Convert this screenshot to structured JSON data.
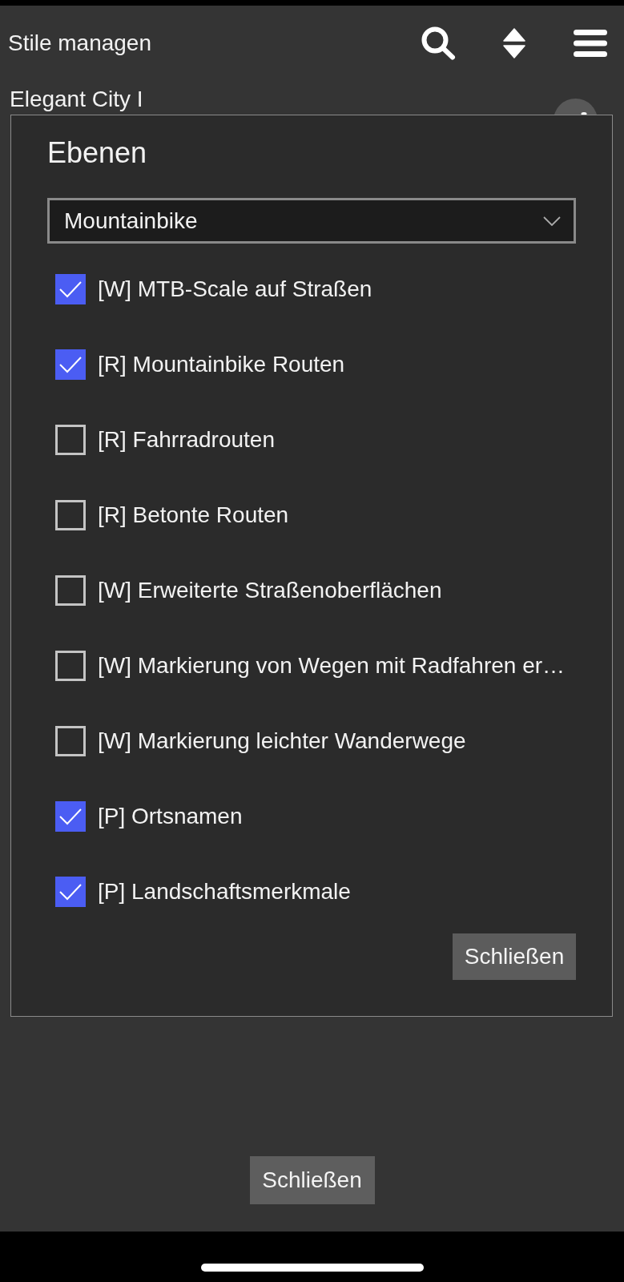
{
  "app_bar": {
    "title": "Stile managen"
  },
  "background_list": {
    "items": [
      {
        "label": "Elegant City I"
      }
    ]
  },
  "dialog": {
    "title": "Ebenen",
    "dropdown": {
      "value": "Mountainbike"
    },
    "layers": [
      {
        "label": "[W] MTB-Scale auf Straßen",
        "checked": true
      },
      {
        "label": "[R] Mountainbike Routen",
        "checked": true
      },
      {
        "label": "[R] Fahrradrouten",
        "checked": false
      },
      {
        "label": "[R] Betonte Routen",
        "checked": false
      },
      {
        "label": "[W] Erweiterte Straßenoberflächen",
        "checked": false
      },
      {
        "label": "[W] Markierung von Wegen mit Radfahren er…",
        "checked": false
      },
      {
        "label": "[W] Markierung leichter Wanderwege",
        "checked": false
      },
      {
        "label": "[P] Ortsnamen",
        "checked": true
      },
      {
        "label": "[P] Landschaftsmerkmale",
        "checked": true
      }
    ],
    "close_button": "Schließen"
  },
  "footer": {
    "close_button": "Schließen"
  }
}
